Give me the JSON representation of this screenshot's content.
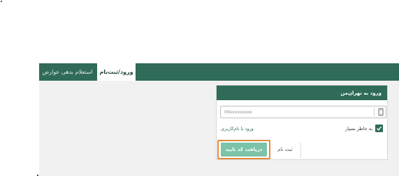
{
  "tabs": [
    {
      "label": "ورود/ثبت‌نام"
    },
    {
      "label": "استعلام بدهی عوارض"
    }
  ],
  "login": {
    "title": "ورود به تهران‌من",
    "phone_placeholder": "09xxxxxxxxx",
    "remember_label": "به خاطر بسپار",
    "remember_checked": true,
    "username_link": "ورود با نام‌کاربری",
    "get_code_label": "دریافت کد تایید",
    "register_label": "ثبت نام"
  },
  "colors": {
    "brand": "#2f6b58",
    "button": "#7cc3a8",
    "highlight": "#e4893a"
  },
  "icons": [
    "phone-icon",
    "check-icon"
  ]
}
